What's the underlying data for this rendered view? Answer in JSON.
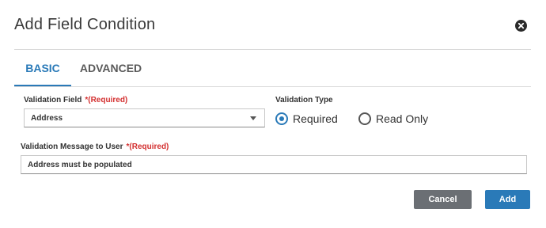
{
  "dialog": {
    "title": "Add Field Condition",
    "close_icon": "close-circle-icon"
  },
  "tabs": [
    {
      "label": "BASIC",
      "active": true
    },
    {
      "label": "ADVANCED",
      "active": false
    }
  ],
  "form": {
    "validation_field": {
      "label": "Validation Field",
      "required_marker": "*(Required)",
      "value": "Address"
    },
    "validation_type": {
      "label": "Validation Type",
      "options": [
        {
          "label": "Required",
          "selected": true
        },
        {
          "label": "Read Only",
          "selected": false
        }
      ]
    },
    "validation_message": {
      "label": "Validation Message to User",
      "required_marker": "*(Required)",
      "value": "Address must be populated"
    }
  },
  "buttons": {
    "cancel": "Cancel",
    "add": "Add"
  },
  "colors": {
    "accent": "#2a7ab8",
    "required": "#d32f2f",
    "cancel_bg": "#6b6f74"
  }
}
